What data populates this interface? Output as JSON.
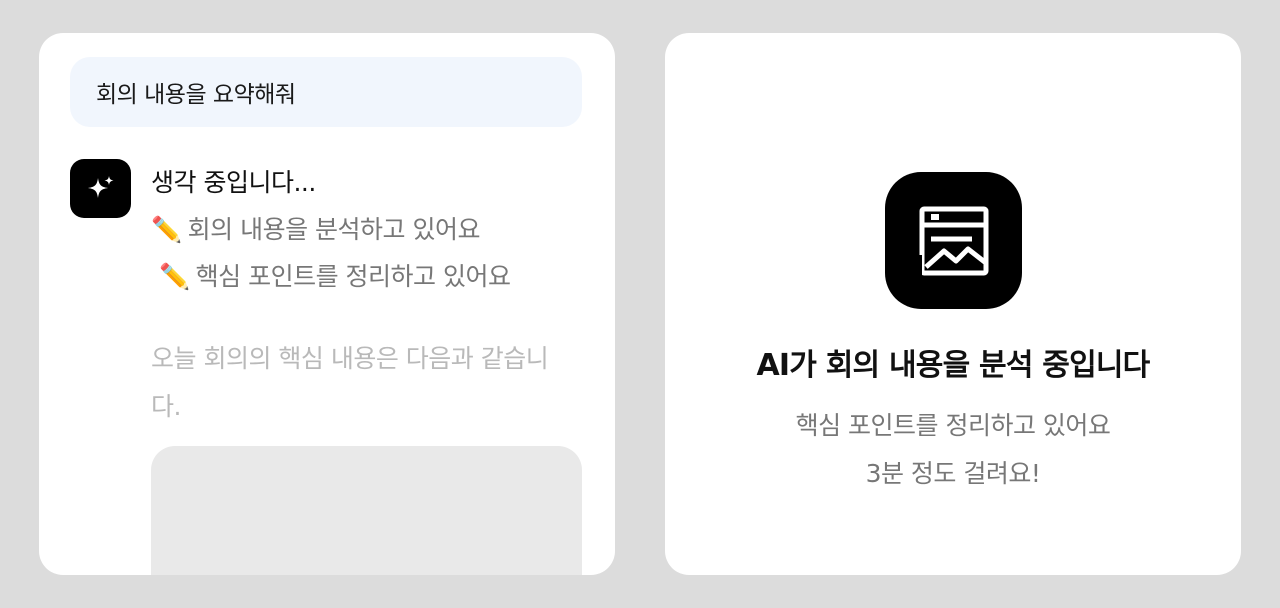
{
  "chat": {
    "user_message": "회의 내용을 요약해줘",
    "ai_avatar_icon": "sparkle-icon",
    "thinking_title": "생각 중입니다...",
    "steps": [
      {
        "emoji": "✏️",
        "text": "회의 내용을 분석하고 있어요"
      },
      {
        "emoji": "✏️",
        "text": "핵심 포인트를 정리하고 있어요"
      }
    ],
    "answer_preview": "오늘 회의의 핵심 내용은 다음과 같습니다."
  },
  "status": {
    "icon": "document-chart-icon",
    "title": "AI가 회의 내용을 분석 중입니다",
    "lines": [
      "핵심 포인트를 정리하고 있어요",
      "3분 정도 걸려요!"
    ]
  },
  "colors": {
    "page_background": "#dcdcdc",
    "user_bubble": "#f1f6fd",
    "icon_background": "#000000",
    "muted_text": "#777777",
    "faded_text": "#b9b9b9"
  }
}
